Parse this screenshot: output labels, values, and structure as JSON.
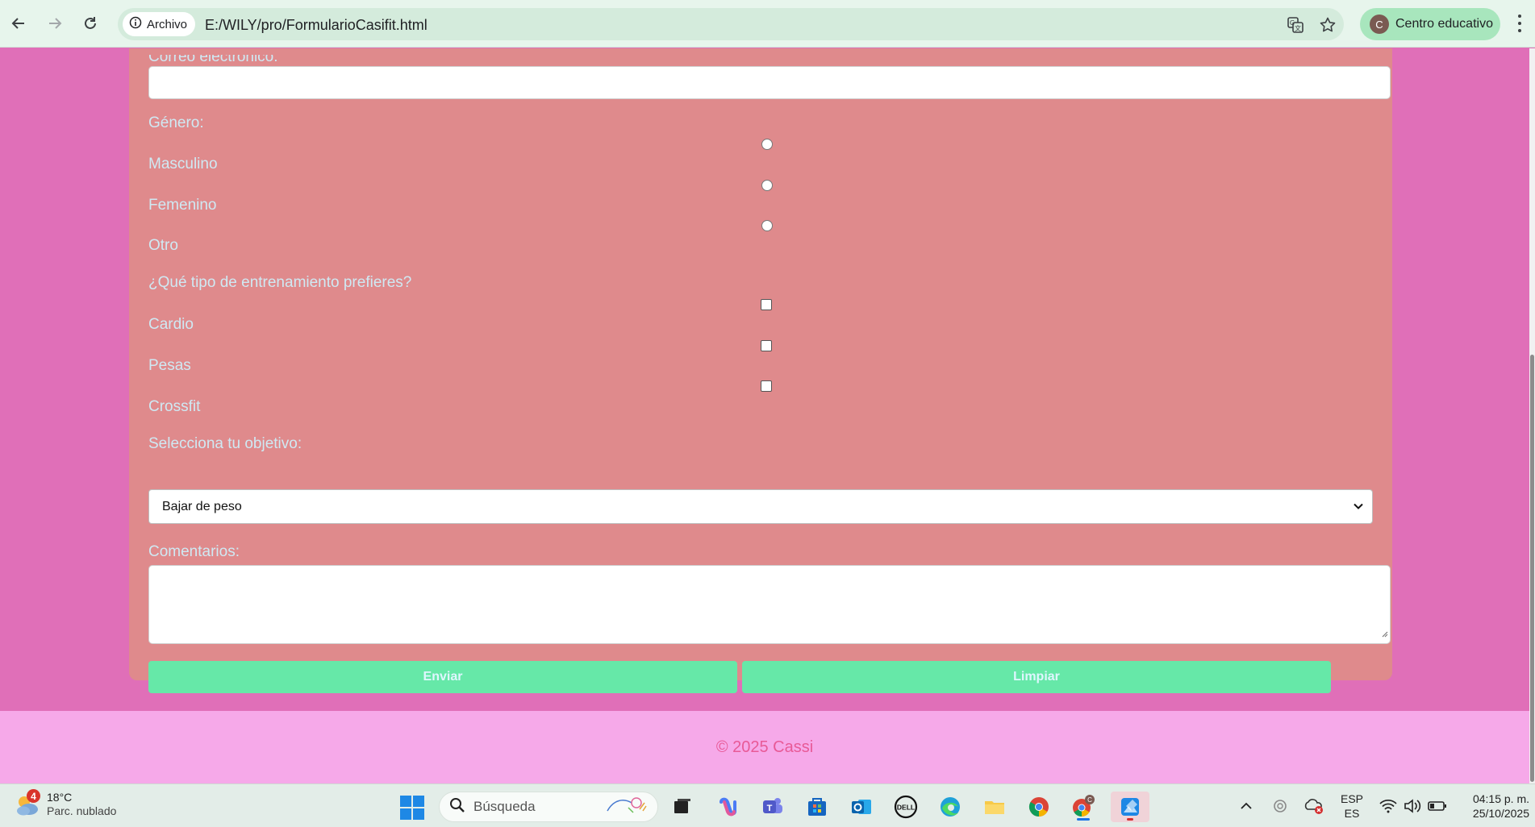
{
  "browser": {
    "site_chip": "Archivo",
    "url": "E:/WILY/pro/FormularioCasifit.html",
    "profile_initial": "C",
    "profile_name": "Centro educativo"
  },
  "form": {
    "email_label": "Correo electrónico:",
    "gender_label": "Género:",
    "gender_options": [
      "Masculino",
      "Femenino",
      "Otro"
    ],
    "training_label": "¿Qué tipo de entrenamiento prefieres?",
    "training_options": [
      "Cardio",
      "Pesas",
      "Crossfit"
    ],
    "goal_label": "Selecciona tu objetivo:",
    "goal_selected": "Bajar de peso",
    "comments_label": "Comentarios:",
    "submit_label": "Enviar",
    "reset_label": "Limpiar"
  },
  "footer": {
    "text": "© 2025 Cassi"
  },
  "taskbar": {
    "weather_badge": "4",
    "weather_temp": "18°C",
    "weather_condition": "Parc. nublado",
    "search_placeholder": "Búsqueda",
    "lang_top": "ESP",
    "lang_bottom": "ES",
    "time": "04:15 p. m.",
    "date": "25/10/2025"
  },
  "colors": {
    "page_bg": "#e06fb8",
    "form_bg": "#df8a8c",
    "label_text": "#cfe9f3",
    "button_bg": "#66e8a8",
    "footer_bg": "#f6a9e9",
    "footer_text": "#e85a97"
  }
}
